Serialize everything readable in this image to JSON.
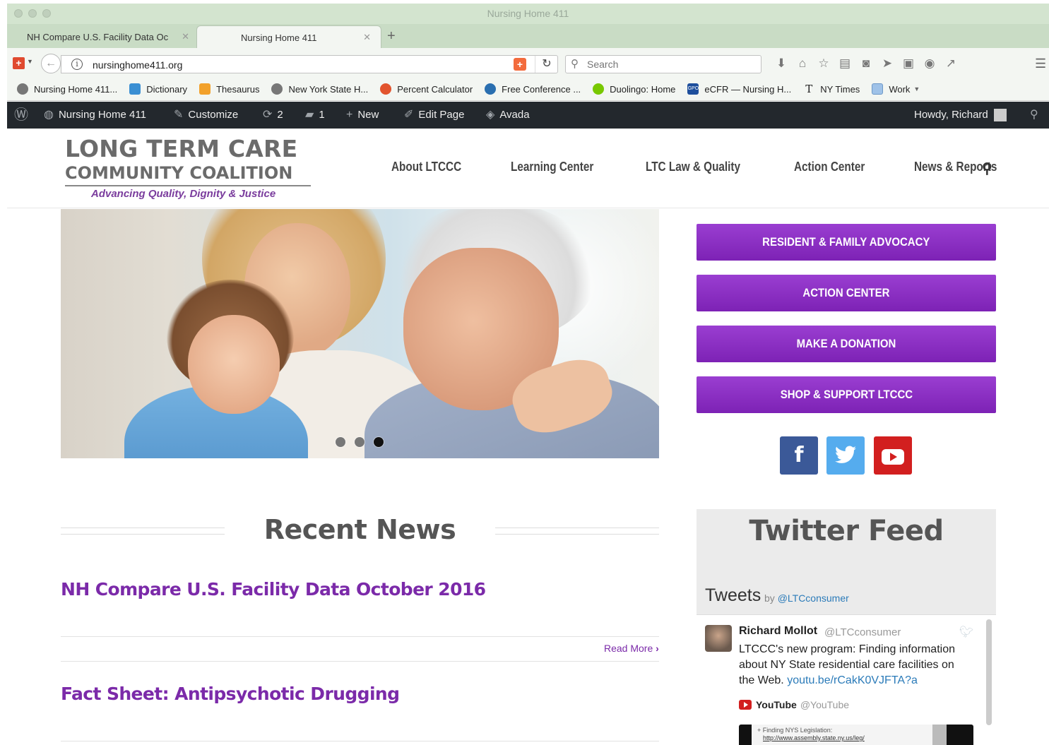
{
  "browser": {
    "window_title": "Nursing Home 411",
    "tabs": [
      {
        "label": "NH Compare U.S. Facility Data Oc",
        "active": false
      },
      {
        "label": "Nursing Home 411",
        "active": true
      }
    ],
    "url": "nursinghome411.org",
    "search_placeholder": "Search",
    "bookmarks": [
      {
        "label": "Nursing Home 411...",
        "icon": "globe-icon"
      },
      {
        "label": "Dictionary",
        "icon": "dictionary-icon"
      },
      {
        "label": "Thesaurus",
        "icon": "thesaurus-icon"
      },
      {
        "label": "New York State H...",
        "icon": "globe-icon"
      },
      {
        "label": "Percent Calculator",
        "icon": "calculator-icon"
      },
      {
        "label": "Free Conference ...",
        "icon": "conference-icon"
      },
      {
        "label": "Duolingo: Home",
        "icon": "duolingo-icon"
      },
      {
        "label": "eCFR — Nursing H...",
        "icon": "gpo-icon"
      },
      {
        "label": "NY Times",
        "icon": "nytimes-icon"
      },
      {
        "label": "Work",
        "icon": "folder-icon"
      }
    ]
  },
  "admin_bar": {
    "site": "Nursing Home 411",
    "customize": "Customize",
    "updates": "2",
    "comments": "1",
    "new": "New",
    "edit": "Edit Page",
    "theme": "Avada",
    "howdy": "Howdy, Richard"
  },
  "site": {
    "logo_line1": "LONG TERM CARE",
    "logo_line2": "COMMUNITY COALITION",
    "logo_tagline": "Advancing Quality, Dignity & Justice",
    "nav": [
      "About LTCCC",
      "Learning Center",
      "LTC Law & Quality",
      "Action Center",
      "News & Reports"
    ]
  },
  "hero": {
    "slides": 3,
    "active_slide": 3
  },
  "cta_buttons": [
    "RESIDENT & FAMILY ADVOCACY",
    "ACTION CENTER",
    "MAKE A DONATION",
    "SHOP & SUPPORT LTCCC"
  ],
  "social": {
    "facebook": "f"
  },
  "news": {
    "heading": "Recent News",
    "items": [
      {
        "title": "NH Compare U.S. Facility Data October 2016",
        "read_more": "Read More"
      },
      {
        "title": "Fact Sheet: Antipsychotic Drugging"
      }
    ]
  },
  "twitter": {
    "heading": "Twitter Feed",
    "tweets_label": "Tweets",
    "by_label": "by",
    "account": "@LTCconsumer",
    "tweet": {
      "name": "Richard Mollot",
      "handle": "@LTCconsumer",
      "text": "LTCCC's new program: Finding information about NY State residential care facilities on the Web.",
      "link": "youtu.be/rCakK0VJFTA?a",
      "card_name": "YouTube",
      "card_handle": "@YouTube",
      "embed_line1": "+ Finding NYS Legislation:",
      "embed_line2": "http://www.assembly.state.ny.us/leg/"
    }
  },
  "colors": {
    "accent_purple": "#7b2aa9",
    "admin_bar": "#23282d",
    "facebook": "#3b5998",
    "twitter": "#55acee",
    "youtube": "#d21f1f"
  }
}
